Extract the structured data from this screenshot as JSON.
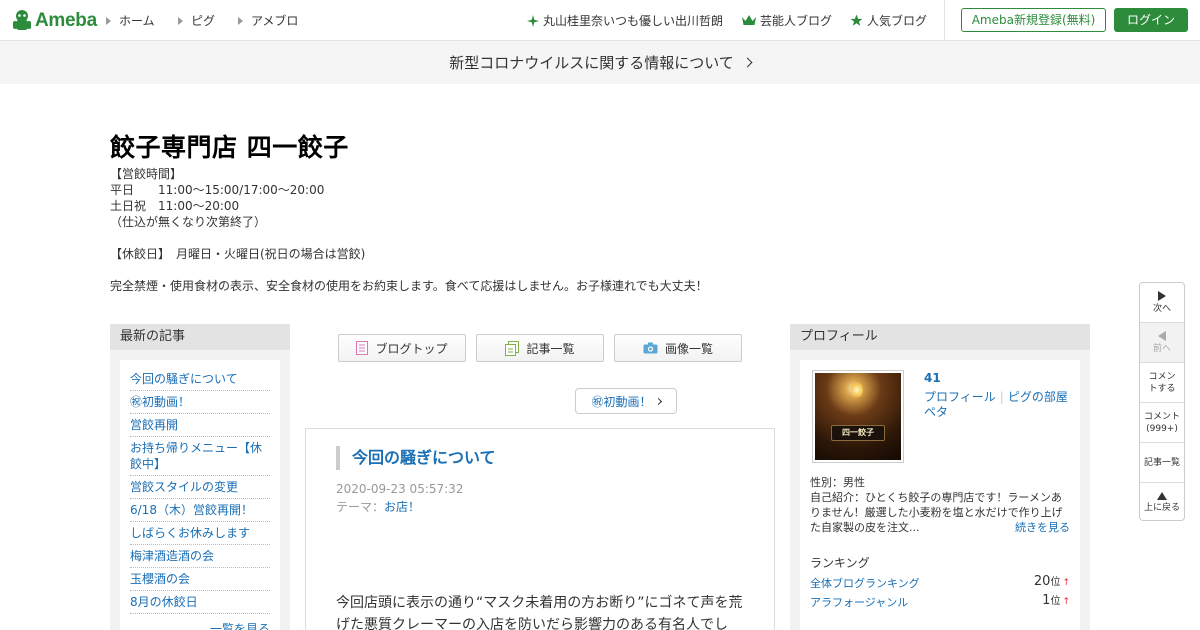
{
  "header": {
    "logo_text": "Ameba",
    "nav": [
      {
        "label": "ホーム"
      },
      {
        "label": "ピグ"
      },
      {
        "label": "アメブロ"
      }
    ],
    "trending": "丸山桂里奈いつも優しい出川哲朗",
    "celebrity_blog": "芸能人ブログ",
    "popular_blog": "人気ブログ",
    "register_label": "Ameba新規登録(無料)",
    "login_label": "ログイン",
    "accent_color": "#2d8c3c"
  },
  "banner": {
    "text": "新型コロナウイルスに関する情報について"
  },
  "blog": {
    "title": "餃子専門店 四一餃子",
    "description": "【営餃時間】\n平日　　11:00～15:00/17:00～20:00\n土日祝　11:00～20:00\n（仕込が無くなり次第終了）\n\n【休餃日】　月曜日・火曜日(祝日の場合は営餃)\n\n完全禁煙・使用食材の表示、安全食材の使用をお約束します。食べて応援はしません。お子様連れでも大丈夫！"
  },
  "recent": {
    "heading": "最新の記事",
    "items": [
      {
        "label": "今回の騒ぎについて"
      },
      {
        "label": "㊗初動画！"
      },
      {
        "label": "営餃再開"
      },
      {
        "label": "お持ち帰りメニュー【休餃中】"
      },
      {
        "label": "営餃スタイルの変更"
      },
      {
        "label": "6/18（木）営餃再開！"
      },
      {
        "label": "しばらくお休みします"
      },
      {
        "label": "梅津酒造酒の会"
      },
      {
        "label": "玉櫻酒の会"
      },
      {
        "label": "8月の休餃日"
      }
    ],
    "more_label": "一覧を見る"
  },
  "tabs": {
    "blog_top": "ブログトップ",
    "article_list": "記事一覧",
    "image_list": "画像一覧"
  },
  "first_movie": "㊗初動画！",
  "article": {
    "title": "今回の騒ぎについて",
    "date": "2020-09-23 05:57:32",
    "theme_label": "テーマ：",
    "theme": "お店！",
    "body": "今回店頭に表示の通り“マスク未着用の方お断り”にゴネて声を荒げた悪質クレーマーの入店を防いだら影響力のある有名人でし"
  },
  "profile": {
    "heading": "プロフィール",
    "name": "41",
    "link_profile": "プロフィール",
    "link_pig": "ピグの部屋",
    "link_peta": "ペタ",
    "avatar_sign": "四一餃子",
    "sex": "性別：男性",
    "intro": "自己紹介：ひとくち餃子の専門店です！ラーメンありません！厳選した小麦粉を塩と水だけで作り上げた自家製の皮を注文...",
    "more_label": "続きを見る",
    "ranking_heading": "ランキング",
    "rankings": [
      {
        "label": "全体ブログランキング",
        "rank": "20",
        "unit": "位",
        "trend": "↑"
      },
      {
        "label": "アラフォージャンル",
        "rank": "1",
        "unit": "位",
        "trend": "↑"
      }
    ]
  },
  "float_nav": {
    "next": "次へ",
    "prev": "前へ",
    "comment": "コメントする",
    "comment_count_label": "コメント",
    "comment_count": "(999+)",
    "article_list": "記事一覧",
    "back_to_top": "上に戻る"
  }
}
